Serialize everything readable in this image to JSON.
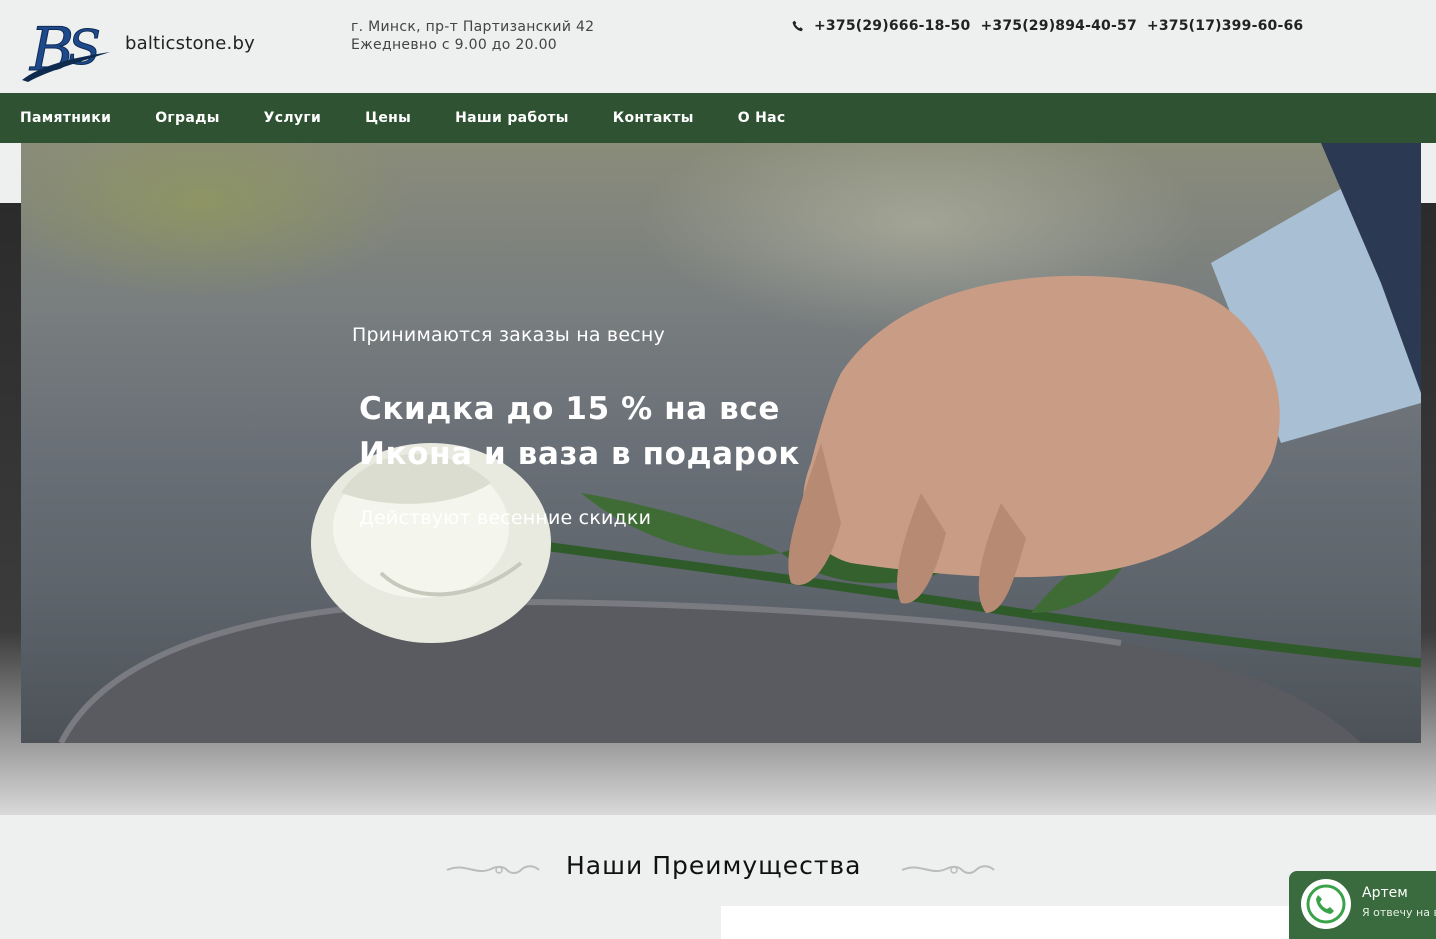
{
  "header": {
    "logo_text": "BS",
    "site_name": "balticstone.by",
    "address_line1": "г. Минск, пр-т Партизанский 42",
    "address_line2": "Ежедневно с 9.00 до 20.00",
    "phones": [
      "+375(29)666-18-50",
      "+375(29)894-40-57",
      "+375(17)399-60-66"
    ],
    "phone_icon": "phone-icon"
  },
  "nav": {
    "items": [
      "Памятники",
      "Ограды",
      "Услуги",
      "Цены",
      "Наши работы",
      "Контакты",
      "О Нас"
    ]
  },
  "hero": {
    "subtitle": "Принимаются заказы на весну",
    "title_line1": "Скидка до 15 % на все",
    "title_line2": "Икона и ваза в подарок",
    "note": "Действуют весенние скидки"
  },
  "advantages": {
    "title": "Наши Преимущества"
  },
  "chat": {
    "name": "Артем",
    "message": "Я отвечу на в",
    "icon": "phone-handset-icon"
  },
  "colors": {
    "nav_bg": "#2f5233",
    "chat_bg": "#3a6b3e",
    "logo_blue": "#1e4a8c"
  }
}
